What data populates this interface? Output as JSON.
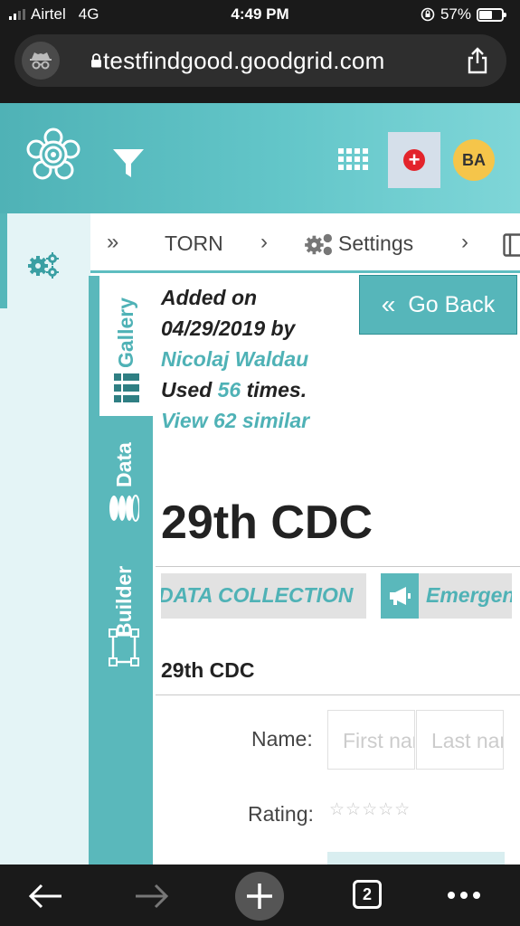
{
  "status_bar": {
    "carrier": "Airtel",
    "network": "4G",
    "time": "4:49 PM",
    "battery": "57%",
    "battery_level": 0.57
  },
  "browser": {
    "url": "testfindgood.goodgrid.com",
    "tab_count": "2"
  },
  "header": {
    "avatar_initials": "BA"
  },
  "breadcrumbs": {
    "item1": "TORN",
    "item2": "Settings"
  },
  "vertical_tabs": {
    "gallery": "Gallery",
    "data": "Data",
    "builder": "Builder"
  },
  "info": {
    "added_on_label": "Added on",
    "date": "04/29/2019 by",
    "author": "Nicolaj Waldau",
    "used_prefix": "Used ",
    "used_count": "56",
    "used_suffix": " times.",
    "view_similar": "View 62 similar"
  },
  "go_back_label": "Go Back",
  "page_title": "29th CDC",
  "tags": {
    "tag1": "DATA COLLECTION",
    "tag2": "Emergency"
  },
  "form": {
    "title": "29th CDC",
    "name_label": "Name:",
    "first_placeholder": "First name",
    "last_placeholder": "Last name",
    "rating_label": "Rating:",
    "rating_stars": "☆☆☆☆☆"
  },
  "colors": {
    "teal": "#56b6ba",
    "brand_gradient_end": "#7fd6d8",
    "add_red": "#e3242b",
    "avatar_yellow": "#f5c54a"
  }
}
